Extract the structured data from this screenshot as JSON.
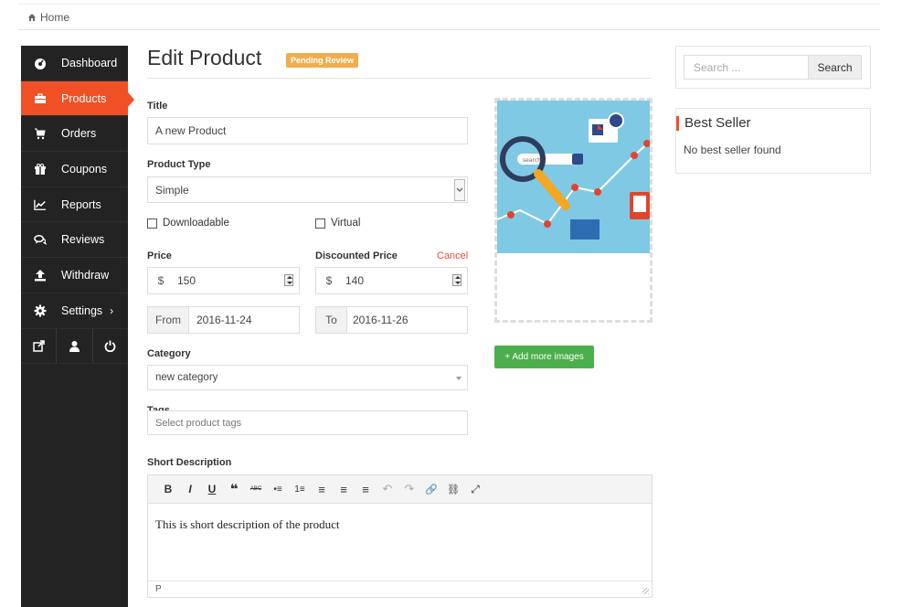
{
  "breadcrumb": {
    "home_label": "Home"
  },
  "sidebar": {
    "items": [
      {
        "label": "Dashboard",
        "icon": "dashboard-icon"
      },
      {
        "label": "Products",
        "icon": "briefcase-icon",
        "active": true
      },
      {
        "label": "Orders",
        "icon": "cart-icon"
      },
      {
        "label": "Coupons",
        "icon": "gift-icon"
      },
      {
        "label": "Reports",
        "icon": "line-chart-icon"
      },
      {
        "label": "Reviews",
        "icon": "comments-icon"
      },
      {
        "label": "Withdraw",
        "icon": "upload-icon"
      },
      {
        "label": "Settings",
        "icon": "gear-icon",
        "chevron": "›"
      }
    ],
    "bottom_icons": [
      "external-link-icon",
      "user-icon",
      "power-icon"
    ],
    "active_color": "#f05025"
  },
  "page": {
    "title": "Edit Product",
    "status_badge": "Pending Review",
    "badge_color": "#f0ad4e"
  },
  "form": {
    "title_label": "Title",
    "title_value": "A new Product",
    "product_type_label": "Product Type",
    "product_type_value": "Simple",
    "downloadable_label": "Downloadable",
    "virtual_label": "Virtual",
    "price_label": "Price",
    "price_currency": "$",
    "price_value": "150",
    "discounted_price_label": "Discounted Price",
    "cancel_label": "Cancel",
    "discount_currency": "$",
    "discount_value": "140",
    "from_label": "From",
    "from_value": "2016-11-24",
    "to_label": "To",
    "to_value": "2016-11-26",
    "category_label": "Category",
    "category_value": "new category",
    "tags_label": "Tags",
    "tags_placeholder": "Select product tags",
    "short_description_label": "Short Description",
    "short_description_value": "This is short description of the product",
    "editor_status_path": "P",
    "editor_toolbar": [
      "B",
      "I",
      "U",
      "❝",
      "ABC",
      "•≡",
      "1≡",
      "≡",
      "≡",
      "≡",
      "↶",
      "↷",
      "🔗",
      "⛓",
      "⤢"
    ]
  },
  "images": {
    "add_more_label": "+ Add more images",
    "thumbnail_search_text": "search..."
  },
  "widgets": {
    "search_placeholder": "Search ...",
    "search_button": "Search",
    "best_seller_title": "Best Seller",
    "best_seller_empty": "No best seller found"
  }
}
